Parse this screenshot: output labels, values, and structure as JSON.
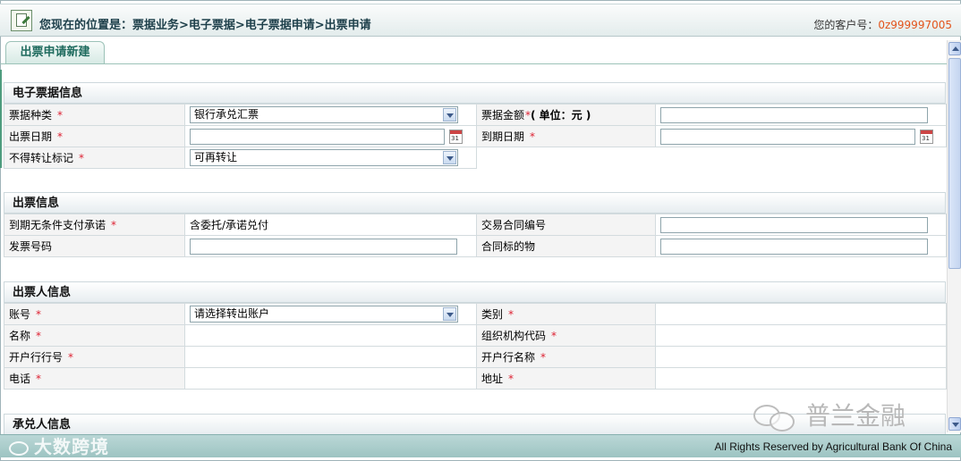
{
  "header": {
    "location": "您现在的位置是：票据业务>电子票据>电子票据申请>出票申请",
    "customer_label": "您的客户号：",
    "customer_id": "0z999997005"
  },
  "tab": {
    "label": "出票申请新建"
  },
  "required_mark": "*",
  "section_bill": {
    "title": "电子票据信息",
    "bill_type_label": "票据种类",
    "bill_type_value": "银行承兑汇票",
    "amount_label": "票据金额",
    "amount_unit": "( 单位：元 )",
    "issue_date_label": "出票日期",
    "due_date_label": "到期日期",
    "calendar_text": "31",
    "transfer_label": "不得转让标记",
    "transfer_value": "可再转让"
  },
  "section_issue": {
    "title": "出票信息",
    "promise_label": "到期无条件支付承诺",
    "promise_value": "含委托/承诺兑付",
    "contract_no_label": "交易合同编号",
    "invoice_label": "发票号码",
    "contract_item_label": "合同标的物"
  },
  "section_drawer": {
    "title": "出票人信息",
    "account_label": "账号",
    "account_value": "请选择转出账户",
    "category_label": "类别",
    "name_label": "名称",
    "org_code_label": "组织机构代码",
    "bank_no_label": "开户行行号",
    "bank_name_label": "开户行名称",
    "phone_label": "电话",
    "address_label": "地址"
  },
  "section_acceptor": {
    "title": "承兑人信息"
  },
  "footer": {
    "copyright": "All Rights Reserved by Agricultural Bank Of China"
  },
  "watermarks": {
    "left": "大数跨境",
    "right": "普兰金融"
  }
}
